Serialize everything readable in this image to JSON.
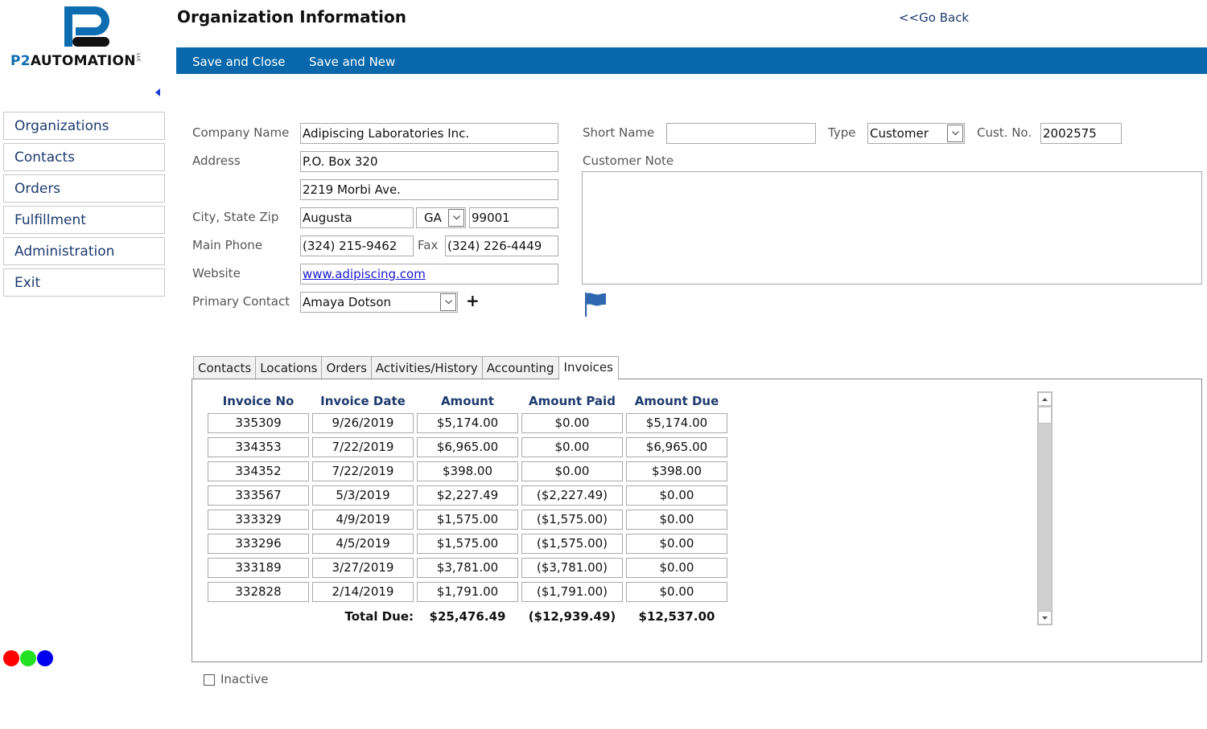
{
  "brand": {
    "logo_prefix": "P2",
    "logo_name": "AUTOMATION",
    "logo_suffix": "LLC",
    "primary_color": "#0868ab"
  },
  "header": {
    "title": "Organization Information",
    "go_back": "<<Go Back"
  },
  "toolbar": {
    "save_close": "Save and Close",
    "save_new": "Save and New"
  },
  "sidebar": {
    "items": [
      {
        "label": "Organizations"
      },
      {
        "label": "Contacts"
      },
      {
        "label": "Orders"
      },
      {
        "label": "Fulfillment"
      },
      {
        "label": "Administration"
      },
      {
        "label": "Exit"
      }
    ]
  },
  "form": {
    "company_name_label": "Company Name",
    "company_name": "Adipiscing Laboratories Inc.",
    "address_label": "Address",
    "address1": "P.O. Box 320",
    "address2": "2219 Morbi Ave.",
    "city_state_zip_label": "City, State Zip",
    "city": "Augusta",
    "state": "GA",
    "zip": "99001",
    "main_phone_label": "Main Phone",
    "main_phone": "(324) 215-9462",
    "fax_label": "Fax",
    "fax": "(324) 226-4449",
    "website_label": "Website",
    "website": "www.adipiscing.com",
    "primary_contact_label": "Primary Contact",
    "primary_contact": "Amaya Dotson",
    "add_contact": "+",
    "short_name_label": "Short Name",
    "short_name": "",
    "type_label": "Type",
    "type": "Customer",
    "cust_no_label": "Cust. No.",
    "cust_no": "2002575",
    "customer_note_label": "Customer Note",
    "customer_note": ""
  },
  "tabs": [
    {
      "label": "Contacts",
      "active": false
    },
    {
      "label": "Locations",
      "active": false
    },
    {
      "label": "Orders",
      "active": false
    },
    {
      "label": "Activities/History",
      "active": false
    },
    {
      "label": "Accounting",
      "active": false
    },
    {
      "label": "Invoices",
      "active": true
    }
  ],
  "invoices": {
    "columns": [
      "Invoice No",
      "Invoice Date",
      "Amount",
      "Amount Paid",
      "Amount Due"
    ],
    "rows": [
      [
        "335309",
        "9/26/2019",
        "$5,174.00",
        "$0.00",
        "$5,174.00"
      ],
      [
        "334353",
        "7/22/2019",
        "$6,965.00",
        "$0.00",
        "$6,965.00"
      ],
      [
        "334352",
        "7/22/2019",
        "$398.00",
        "$0.00",
        "$398.00"
      ],
      [
        "333567",
        "5/3/2019",
        "$2,227.49",
        "($2,227.49)",
        "$0.00"
      ],
      [
        "333329",
        "4/9/2019",
        "$1,575.00",
        "($1,575.00)",
        "$0.00"
      ],
      [
        "333296",
        "4/5/2019",
        "$1,575.00",
        "($1,575.00)",
        "$0.00"
      ],
      [
        "333189",
        "3/27/2019",
        "$3,781.00",
        "($3,781.00)",
        "$0.00"
      ],
      [
        "332828",
        "2/14/2019",
        "$1,791.00",
        "($1,791.00)",
        "$0.00"
      ]
    ],
    "total_label": "Total Due:",
    "total_amount": "$25,476.49",
    "total_paid": "($12,939.49)",
    "total_due": "$12,537.00"
  },
  "footer": {
    "inactive_label": "Inactive",
    "inactive_checked": false,
    "status_dots": [
      "#ff0000",
      "#22e022",
      "#0000ee"
    ]
  }
}
